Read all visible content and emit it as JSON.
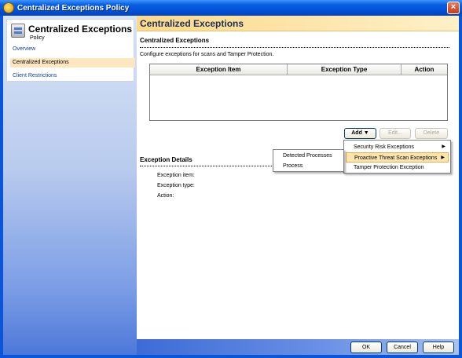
{
  "window": {
    "title": "Centralized Exceptions Policy",
    "close_label": "×"
  },
  "sidebar": {
    "title": "Centralized Exceptions",
    "subtitle": "Policy",
    "items": [
      {
        "label": "Overview"
      },
      {
        "label": "Centralized Exceptions"
      },
      {
        "label": "Client Restrictions"
      }
    ]
  },
  "main": {
    "title": "Centralized Exceptions",
    "section_title": "Centralized Exceptions",
    "description": "Configure exceptions for scans and Tamper Protection.",
    "table": {
      "columns": [
        "Exception Item",
        "Exception Type",
        "Action"
      ],
      "rows": []
    },
    "buttons": {
      "add": "Add ▼",
      "edit": "Edit...",
      "delete": "Delete"
    },
    "details": {
      "title": "Exception Details",
      "labels": [
        "Exception item:",
        "Exception type:",
        "Action:"
      ]
    }
  },
  "add_menu": {
    "items": [
      {
        "label": "Security Risk Exceptions"
      },
      {
        "label": "Proactive Threat Scan Exceptions"
      },
      {
        "label": "Tamper Protection Exception"
      }
    ]
  },
  "submenu": {
    "items": [
      {
        "label": "Detected Processes"
      },
      {
        "label": "Process"
      }
    ]
  },
  "footer": {
    "ok": "OK",
    "cancel": "Cancel",
    "help": "Help"
  }
}
